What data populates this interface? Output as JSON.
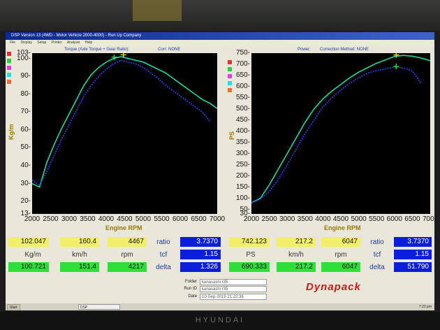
{
  "window": {
    "title": "DSP Version 13 (4WD - Motor Vehicle 2000-4000) - Run Up Company",
    "menu": [
      "File",
      "Display",
      "Setup",
      "Printer",
      "Analysis",
      "Help"
    ]
  },
  "charts": {
    "torque": {
      "title": "Torque (Axle Torque + Gear Ratio):",
      "correction": "Corr: NONE",
      "ylabel": "Kg/m",
      "xlabel": "Engine RPM",
      "yticks": [
        "103-",
        "100-",
        "90-",
        "80-",
        "70-",
        "60-",
        "50-",
        "40-",
        "30-",
        "20-",
        "13-"
      ],
      "xticks": [
        "2000",
        "2500",
        "3000",
        "3500",
        "4000",
        "4500",
        "5000",
        "5500",
        "6000",
        "6500",
        "7000"
      ]
    },
    "power": {
      "title": "Power:",
      "correction": "Correction Method: NONE",
      "ylabel": "PS",
      "xlabel": "Engine RPM",
      "yticks": [
        "750-",
        "700-",
        "650-",
        "600-",
        "550-",
        "500-",
        "450-",
        "400-",
        "350-",
        "300-",
        "250-",
        "200-",
        "150-",
        "100-",
        "50-",
        "30-"
      ],
      "xticks": [
        "2000",
        "2500",
        "3000",
        "3500",
        "4000",
        "4500",
        "5000",
        "5500",
        "6000",
        "6500",
        "7000"
      ]
    },
    "colors": {
      "run1": "#20d8a0",
      "run2": "#2e44e8",
      "marker1": "#e8e020",
      "marker2": "#22e040"
    }
  },
  "chart_data": [
    {
      "type": "line",
      "title": "Torque (Axle Torque + Gear Ratio):",
      "xlabel": "Engine RPM",
      "ylabel": "Kg/m",
      "xlim": [
        2000,
        7000
      ],
      "ylim": [
        13,
        103
      ],
      "grid": false,
      "series": [
        {
          "x": [
            2000,
            2200,
            2400,
            2600,
            2800,
            3000,
            3200,
            3400,
            3600,
            3800,
            4000,
            4200,
            4400,
            4600,
            4800,
            5000,
            5200,
            5400,
            5600,
            5800,
            6000,
            6200,
            6400,
            6600,
            6800,
            7000
          ],
          "y": [
            30,
            28,
            42,
            52,
            61,
            69,
            77,
            85,
            91,
            95,
            98,
            100,
            101,
            100,
            99,
            98,
            96,
            94,
            92,
            89,
            86,
            83,
            80,
            77,
            75,
            72
          ]
        },
        {
          "x": [
            2000,
            2200,
            2400,
            2600,
            2800,
            3000,
            3200,
            3400,
            3600,
            3800,
            4000,
            4200,
            4400,
            4600,
            4800,
            5000,
            5200,
            5400,
            5600,
            5800,
            6000,
            6200,
            6400,
            6600,
            6800
          ],
          "y": [
            32,
            29,
            37,
            46,
            55,
            63,
            71,
            79,
            85,
            90,
            94,
            97,
            99,
            98,
            97,
            95,
            92,
            89,
            85,
            82,
            79,
            76,
            73,
            70,
            65
          ]
        }
      ],
      "markers": [
        {
          "x": 4467,
          "y": 102.047
        },
        {
          "x": 4217,
          "y": 100.721
        }
      ]
    },
    {
      "type": "line",
      "title": "Power:",
      "xlabel": "Engine RPM",
      "ylabel": "PS",
      "xlim": [
        2000,
        7000
      ],
      "ylim": [
        30,
        750
      ],
      "grid": false,
      "series": [
        {
          "x": [
            2000,
            2250,
            2500,
            2750,
            3000,
            3250,
            3500,
            3750,
            4000,
            4250,
            4500,
            4750,
            5000,
            5250,
            5500,
            5750,
            6000,
            6250,
            6500,
            6750,
            7000
          ],
          "y": [
            80,
            100,
            160,
            230,
            300,
            370,
            440,
            500,
            545,
            580,
            610,
            640,
            665,
            685,
            705,
            720,
            735,
            740,
            736,
            728,
            716
          ]
        },
        {
          "x": [
            2000,
            2250,
            2500,
            2750,
            3000,
            3250,
            3500,
            3750,
            4000,
            4250,
            4500,
            4750,
            5000,
            5250,
            5500,
            5750,
            6000,
            6250,
            6500,
            6750
          ],
          "y": [
            80,
            96,
            130,
            185,
            250,
            320,
            390,
            450,
            510,
            550,
            585,
            615,
            640,
            660,
            672,
            680,
            688,
            684,
            670,
            615
          ]
        }
      ],
      "markers": [
        {
          "x": 6047,
          "y": 742.123
        },
        {
          "x": 6047,
          "y": 690.333
        }
      ]
    }
  ],
  "readouts": {
    "torque": {
      "run1": {
        "value": "102.047",
        "speed": "160.4",
        "rpm": "4467"
      },
      "units": {
        "value": "Kg/m",
        "speed": "km/h",
        "rpm": "rpm"
      },
      "run2": {
        "value": "100.721",
        "speed": "151.4",
        "rpm": "4217"
      },
      "ratio_label": "ratio",
      "ratio": "3.7370",
      "tcf_label": "tcf",
      "tcf": "1.15",
      "delta_label": "delta",
      "delta": "1.326"
    },
    "power": {
      "run1": {
        "value": "742.123",
        "speed": "217.2",
        "rpm": "6047"
      },
      "units": {
        "value": "PS",
        "speed": "km/h",
        "rpm": "rpm"
      },
      "run2": {
        "value": "690.333",
        "speed": "217.2",
        "rpm": "6047"
      },
      "ratio_label": "ratio",
      "ratio": "3.7370",
      "tcf_label": "tcf",
      "tcf": "1.15",
      "delta_label": "delta",
      "delta": "51.790"
    }
  },
  "info": {
    "folder_label": "Folder",
    "folder": "kanasashi r35",
    "runid_label": "Run ID",
    "runid": "kanasashi r35",
    "date_label": "Date",
    "date": "10-Sep-2019 21:22:36"
  },
  "logo": "Dynapack",
  "taskbar": {
    "start": "Start",
    "task": "DSP",
    "clock": "7:22 pm"
  },
  "monitor_brand": "HYUNDAI"
}
